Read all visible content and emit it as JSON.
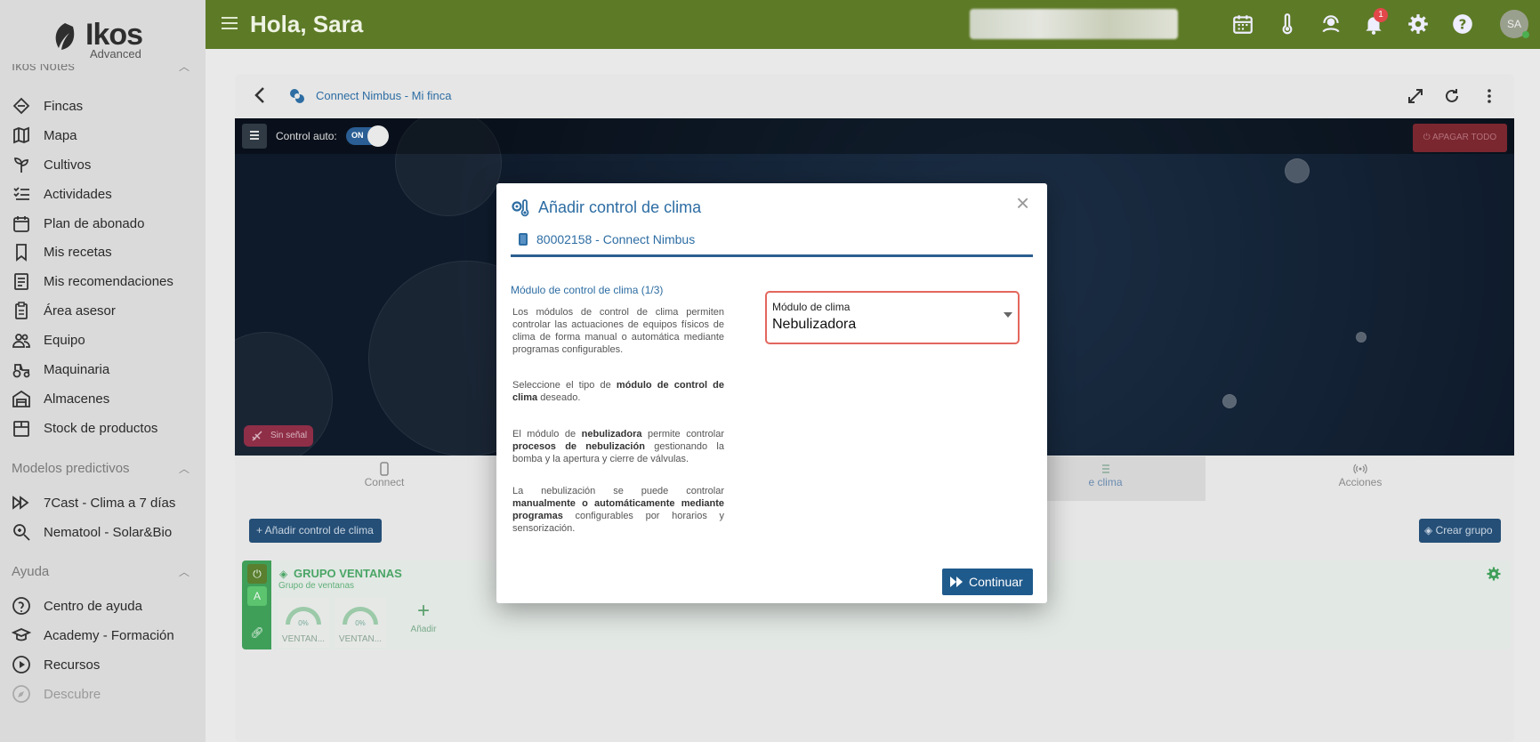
{
  "app": {
    "logo_word": "Ikos",
    "logo_sub": "Advanced",
    "greeting": "Hola, Sara",
    "notification_count": "1",
    "avatar_initials": "SA",
    "brand_color": "#5d7a26"
  },
  "sidebar": {
    "section_notes": "Ikos Notes",
    "items": [
      {
        "label": "Fincas",
        "icon": "fincas-icon"
      },
      {
        "label": "Mapa",
        "icon": "map-icon"
      },
      {
        "label": "Cultivos",
        "icon": "sprout-icon"
      },
      {
        "label": "Actividades",
        "icon": "checklist-icon"
      },
      {
        "label": "Plan de abonado",
        "icon": "calendar-icon"
      },
      {
        "label": "Mis recetas",
        "icon": "bookmark-icon"
      },
      {
        "label": "Mis recomendaciones",
        "icon": "clipboard-list-icon"
      },
      {
        "label": "Área asesor",
        "icon": "clipboard-icon"
      },
      {
        "label": "Equipo",
        "icon": "team-icon"
      },
      {
        "label": "Maquinaria",
        "icon": "tractor-icon"
      },
      {
        "label": "Almacenes",
        "icon": "warehouse-icon"
      },
      {
        "label": "Stock de productos",
        "icon": "box-icon"
      }
    ],
    "section_models": "Modelos predictivos",
    "model_items": [
      {
        "label": "7Cast - Clima a 7 días",
        "icon": "fast-forward-icon"
      },
      {
        "label": "Nematool - Solar&Bio",
        "icon": "search-bug-icon"
      }
    ],
    "section_help": "Ayuda",
    "help_items": [
      {
        "label": "Centro de ayuda",
        "icon": "help-circle-icon"
      },
      {
        "label": "Academy - Formación",
        "icon": "graduation-icon"
      },
      {
        "label": "Recursos",
        "icon": "play-circle-icon"
      },
      {
        "label": "Descubre",
        "icon": "compass-icon"
      }
    ]
  },
  "card": {
    "title": "Connect Nimbus - Mi finca",
    "control_auto_label": "Control auto:",
    "toggle_state": "ON",
    "apagar_label": "APAGAR TODO",
    "signal_label": "Sin señal",
    "tabs": [
      {
        "label": "Connect",
        "icon": "device-icon"
      },
      {
        "label": "e clima",
        "icon": "climate-icon"
      },
      {
        "label": "Acciones",
        "icon": "broadcast-icon"
      }
    ],
    "add_climate_btn": "+ Añadir control de clima",
    "create_group_btn": "Crear grupo",
    "group": {
      "title": "GRUPO VENTANAS",
      "subtitle": "Grupo de ventanas",
      "button_a": "A",
      "gauges": [
        {
          "value": "0%",
          "label": "VENTAN..."
        },
        {
          "value": "0%",
          "label": "VENTAN..."
        }
      ],
      "add_label": "Añadir"
    }
  },
  "modal": {
    "title": "Añadir control de clima",
    "device": "80002158 - Connect Nimbus",
    "step": "Módulo de control de clima (1/3)",
    "p1": "Los módulos de control de clima permiten controlar las actuaciones de equipos físicos de clima de forma manual o automática mediante programas configurables.",
    "p2_pre": "Seleccione el tipo de ",
    "p2_bold": "módulo de control de clima",
    "p2_post": " deseado.",
    "p3_a": "El módulo de ",
    "p3_b": "nebulizadora",
    "p3_c": " permite controlar ",
    "p3_d": "procesos de nebulización",
    "p3_e": " gestionando la bomba y la apertura y cierre de válvulas.",
    "p4_a": "La nebulización se puede controlar ",
    "p4_b": "manualmente o automáticamente mediante programas",
    "p4_c": " configurables por horarios y sensorización.",
    "select_label": "Módulo de clima",
    "select_value": "Nebulizadora",
    "continue_btn": "Continuar"
  }
}
